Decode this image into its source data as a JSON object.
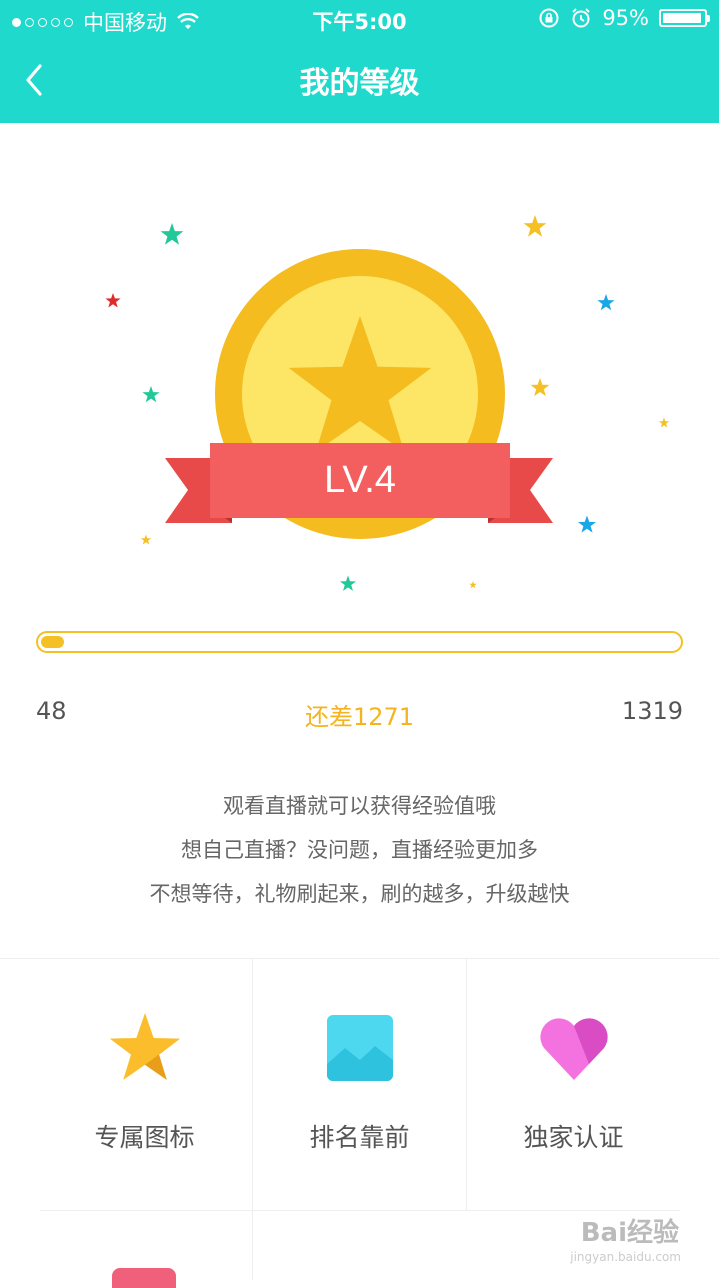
{
  "status_bar": {
    "carrier": "中国移动",
    "time": "下午5:00",
    "battery": "95%"
  },
  "nav": {
    "title": "我的等级"
  },
  "badge": {
    "level": "LV.4"
  },
  "progress": {
    "current": "48",
    "remaining": "还差1271",
    "max": "1319",
    "fraction": 0.036
  },
  "tips": [
    "观看直播就可以获得经验值哦",
    "想自己直播？没问题，直播经验更加多",
    "不想等待，礼物刷起来，刷的越多，升级越快"
  ],
  "privileges": [
    {
      "label": "专属图标",
      "icon": "star-icon"
    },
    {
      "label": "排名靠前",
      "icon": "image-icon"
    },
    {
      "label": "独家认证",
      "icon": "heart-icon"
    }
  ],
  "watermark": {
    "brand": "Bai经验",
    "url": "jingyan.baidu.com"
  },
  "colors": {
    "header": "#1ed9cc",
    "gold": "#f5c023",
    "ribbon": "#f35e5e",
    "text_gray": "#666666"
  }
}
